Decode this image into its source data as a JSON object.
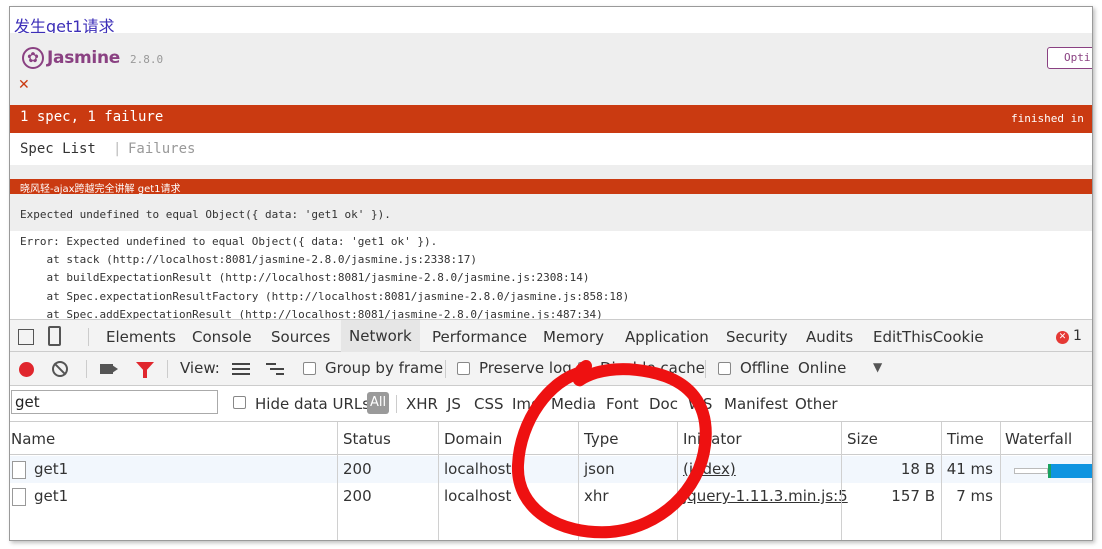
{
  "request_link": "发生get1请求",
  "jasmine": {
    "logo": "Jasmine",
    "version": "2.8.0",
    "options_label": "Opti",
    "summary": "1 spec, 1 failure",
    "finished": "finished in",
    "spec_list": "Spec List",
    "separator": "|",
    "failures": "Failures",
    "suite": "晓风轻-ajax跨越完全讲解 get1请求",
    "expected": "Expected undefined to equal Object({ data: 'get1 ok' }).",
    "trace": [
      "Error: Expected undefined to equal Object({ data: 'get1 ok' }).",
      "    at stack (http://localhost:8081/jasmine-2.8.0/jasmine.js:2338:17)",
      "    at buildExpectationResult (http://localhost:8081/jasmine-2.8.0/jasmine.js:2308:14)",
      "    at Spec.expectationResultFactory (http://localhost:8081/jasmine-2.8.0/jasmine.js:858:18)",
      "    at Spec.addExpectationResult (http://localhost:8081/jasmine-2.8.0/jasmine.js:487:34)"
    ]
  },
  "devtools": {
    "tabs": [
      "Elements",
      "Console",
      "Sources",
      "Network",
      "Performance",
      "Memory",
      "Application",
      "Security",
      "Audits",
      "EditThisCookie"
    ],
    "active_tab": "Network",
    "error_count": "1",
    "toolbar": {
      "view_label": "View:",
      "group_by_frame": "Group by frame",
      "preserve_log": "Preserve log",
      "disable_cache": "Disable cache",
      "offline": "Offline",
      "online": "Online"
    },
    "filter": {
      "value": "get",
      "hide_data_urls": "Hide data URLs",
      "types": [
        "All",
        "XHR",
        "JS",
        "CSS",
        "Img",
        "Media",
        "Font",
        "Doc",
        "WS",
        "Manifest",
        "Other"
      ]
    },
    "columns": [
      "Name",
      "Status",
      "Domain",
      "Type",
      "Initiator",
      "Size",
      "Time",
      "Waterfall"
    ],
    "rows": [
      {
        "name": "get1",
        "status": "200",
        "domain": "localhost",
        "type": "json",
        "initiator": "(index)",
        "size": "18 B",
        "time": "41 ms"
      },
      {
        "name": "get1",
        "status": "200",
        "domain": "localhost",
        "type": "xhr",
        "initiator": "jquery-1.11.3.min.js:5",
        "size": "157 B",
        "time": "7 ms"
      }
    ]
  },
  "colors": {
    "jasmine_fail": "#ca3a11",
    "jasmine_purple": "#8a4182",
    "record_red": "#e0262d",
    "annotation_red": "#ee1111"
  }
}
